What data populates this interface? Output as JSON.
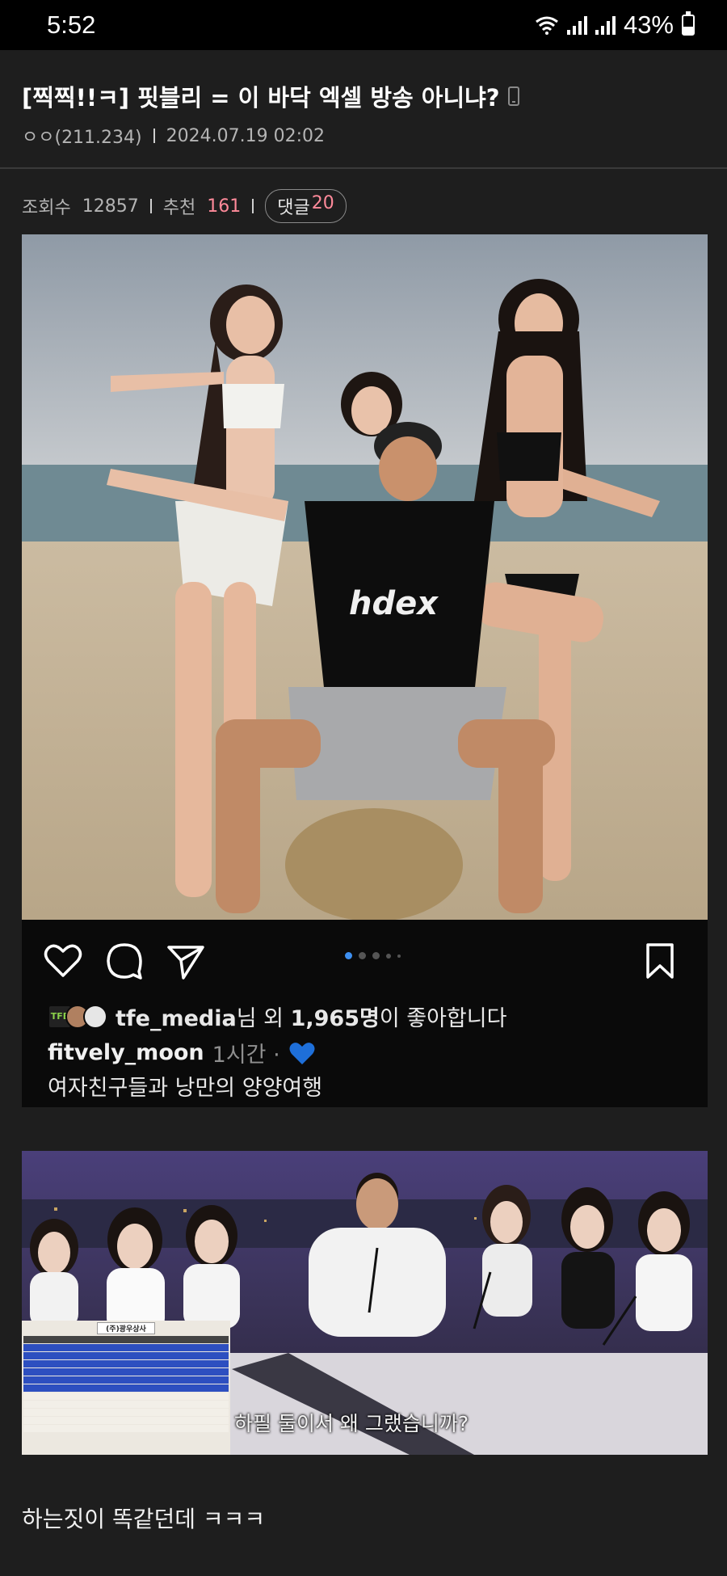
{
  "status_bar": {
    "time": "5:52",
    "battery": "43%",
    "battery_level": 0.43
  },
  "post": {
    "title": "[찍찍!!ㅋ] 핏블리 = 이 바닥 엑셀 방송 아니냐?",
    "author": "ㅇㅇ(211.234)",
    "datetime": "2024.07.19 02:02",
    "views_label": "조회수",
    "views": "12857",
    "recommend_label": "추천",
    "recommend": "161",
    "comments_label": "댓글",
    "comments": "20",
    "body_text": "하는짓이 똑같던데 ㅋㅋㅋ"
  },
  "instagram": {
    "shirt_text": "hdex",
    "carousel_dots": 5,
    "carousel_active": 1,
    "likes_user": "tfe_media",
    "likes_suffix_1": "님 외",
    "likes_count": "1,965명",
    "likes_suffix_2": "이 좋아합니다",
    "caption_user": "fitvely_moon",
    "caption_time": "1시간 ·",
    "caption_text": "여자친구들과 낭만의 양양여행",
    "avatar_badge": "TFE"
  },
  "stream_capture": {
    "subtitle": "하필 둘이서 왜 그랬습니까?",
    "board_title": "(주)광우상사"
  },
  "colors": {
    "background": "#1e1e1e",
    "accent_pink": "#ff8a9a",
    "ig_dot_active": "#3d8ff0"
  }
}
